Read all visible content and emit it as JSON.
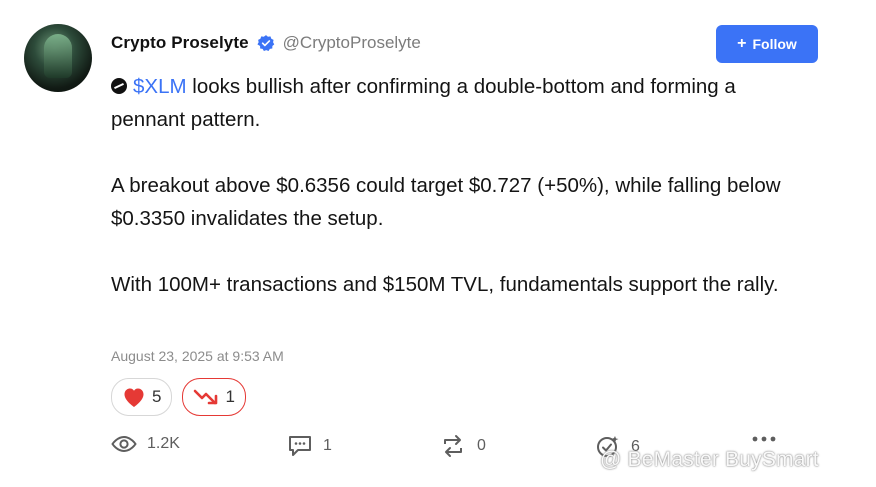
{
  "post": {
    "author_name": "Crypto Proselyte",
    "author_handle": "@CryptoProselyte",
    "follow_label": "Follow",
    "ticker": "$XLM",
    "line1_rest": " looks bullish after confirming a double-bottom and forming a pennant pattern.",
    "paragraph2": "A breakout above $0.6356 could target $0.727 (+50%), while falling below $0.3350 invalidates the setup.",
    "paragraph3": "With 100M+ transactions and $150M TVL, fundamentals support the rally.",
    "timestamp": "August 23, 2025 at 9:53 AM"
  },
  "reactions": [
    {
      "icon": "heart-icon",
      "count": "5"
    },
    {
      "icon": "trend-down-icon",
      "count": "1"
    }
  ],
  "actions": {
    "views": "1.2K",
    "comments": "1",
    "reposts": "0",
    "gift": "6"
  },
  "watermark": "@ BeMaster BuySmart",
  "colors": {
    "accent": "#3b73f6",
    "heart": "#e53935",
    "down": "#e53935"
  }
}
